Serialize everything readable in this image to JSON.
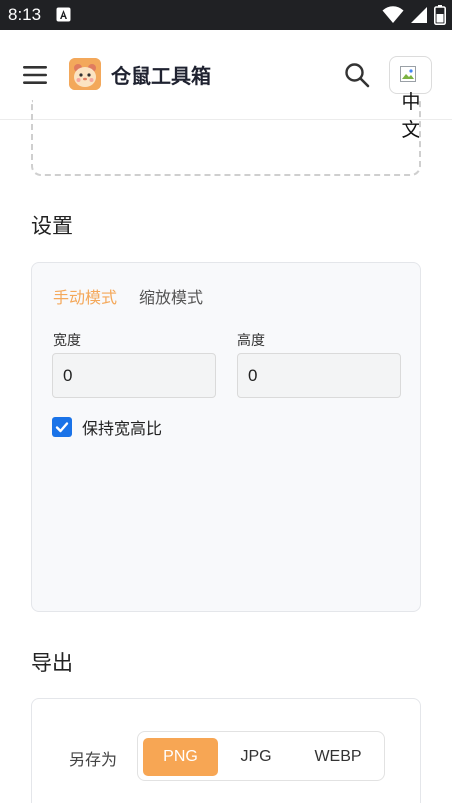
{
  "status_bar": {
    "time": "8:13"
  },
  "app_bar": {
    "title": "仓鼠工具箱",
    "language_label": "中文"
  },
  "settings": {
    "title": "设置",
    "tabs": [
      {
        "label": "手动模式",
        "active": true
      },
      {
        "label": "缩放模式",
        "active": false
      }
    ],
    "width": {
      "label": "宽度",
      "value": "0"
    },
    "height": {
      "label": "高度",
      "value": "0"
    },
    "keep_ratio": {
      "label": "保持宽高比",
      "checked": true
    }
  },
  "export": {
    "title": "导出",
    "save_as_label": "另存为",
    "formats": [
      {
        "label": "PNG",
        "active": true
      },
      {
        "label": "JPG",
        "active": false
      },
      {
        "label": "WEBP",
        "active": false
      }
    ]
  },
  "colors": {
    "accent": "#f7a654",
    "checkbox": "#1a73e8",
    "status_bar": "#202124"
  }
}
